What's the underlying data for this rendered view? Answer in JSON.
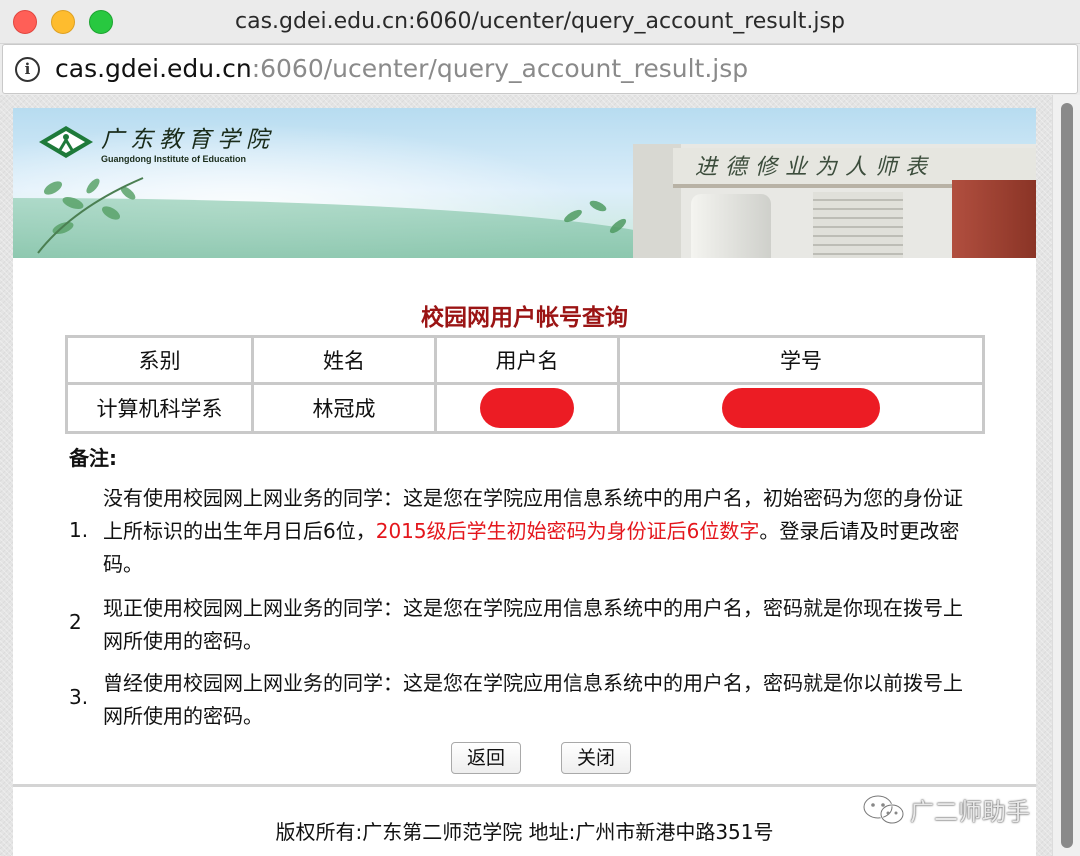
{
  "window": {
    "title": "cas.gdei.edu.cn:6060/ucenter/query_account_result.jsp"
  },
  "address_bar": {
    "url_host": "cas.gdei.edu.cn",
    "url_rest": ":6060/ucenter/query_account_result.jsp"
  },
  "banner": {
    "logo_cn": "广东教育学院",
    "logo_en": "Guangdong Institute of Education",
    "building_sign": "进德修业为人师表"
  },
  "page": {
    "title": "校园网用户帐号查询",
    "table": {
      "headers": [
        "系别",
        "姓名",
        "用户名",
        "学号"
      ],
      "row": {
        "department": "计算机科学系",
        "name": "林冠成"
      }
    },
    "notes": {
      "title": "备注:",
      "items": [
        {
          "num": "1.",
          "text": "没有使用校园网上网业务的同学：这是您在学院应用信息系统中的用户名，初始密码为您的身份证上所标识的出生年月日后6位，",
          "highlight": "2015级后学生初始密码为身份证后6位数字",
          "suffix": "。登录后请及时更改密码。"
        },
        {
          "num": "2",
          "text": "现正使用校园网上网业务的同学：这是您在学院应用信息系统中的用户名，密码就是你现在拨号上网所使用的密码。"
        },
        {
          "num": "3.",
          "text": "曾经使用校园网上网业务的同学：这是您在学院应用信息系统中的用户名，密码就是你以前拨号上网所使用的密码。"
        }
      ]
    },
    "buttons": {
      "back": "返回",
      "close": "关闭"
    },
    "footer": "版权所有:广东第二师范学院 地址:广州市新港中路351号"
  },
  "watermark": {
    "text": "广二师助手"
  },
  "colors": {
    "title_red": "#9b1414",
    "highlight_red": "#e4161c",
    "redaction": "#ec1c24"
  }
}
